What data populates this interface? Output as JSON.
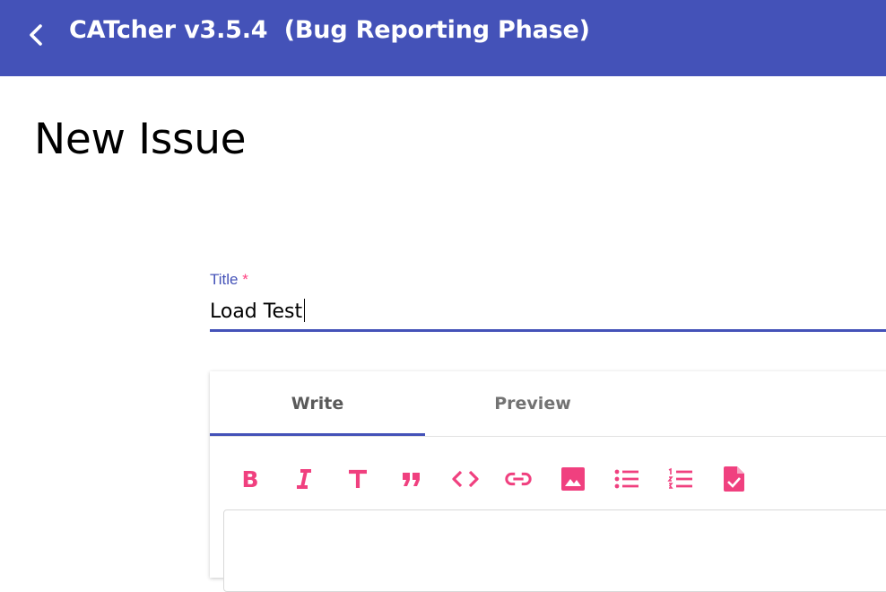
{
  "app": {
    "title": "CATcher v3.5.4  (Bug Reporting Phase)",
    "bar_color": "#4452b8",
    "back_icon": "chevron-left-icon"
  },
  "page": {
    "title": "New Issue"
  },
  "form": {
    "title_label": "Title",
    "required_mark": "*",
    "title_value": "Load Test"
  },
  "editor": {
    "tabs": [
      {
        "label": "Write",
        "active": true
      },
      {
        "label": "Preview",
        "active": false
      }
    ],
    "accent_color": "#f0407f",
    "toolbar": [
      {
        "icon": "bold-icon"
      },
      {
        "icon": "italic-icon"
      },
      {
        "icon": "heading-icon"
      },
      {
        "icon": "quote-icon"
      },
      {
        "icon": "code-icon"
      },
      {
        "icon": "link-icon"
      },
      {
        "icon": "image-icon"
      },
      {
        "icon": "bulleted-list-icon"
      },
      {
        "icon": "numbered-list-icon"
      },
      {
        "icon": "task-file-icon"
      }
    ]
  }
}
